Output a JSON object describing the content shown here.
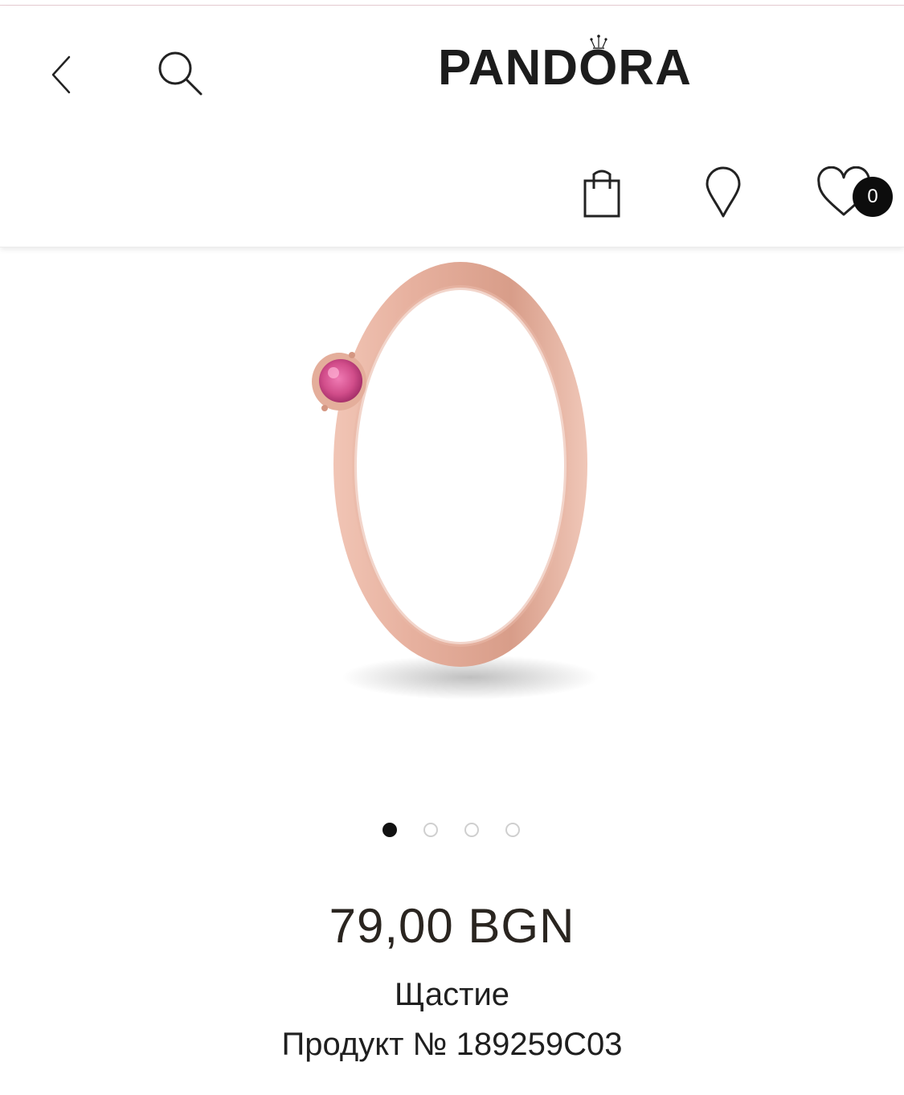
{
  "header": {
    "brand": "PANDORA",
    "wishlist_count": "0",
    "icons": {
      "back": "chevron-left-icon",
      "search": "search-icon",
      "bag": "shopping-bag-icon",
      "store_locator": "map-pin-icon",
      "wishlist": "heart-icon",
      "logo_crown": "crown-icon"
    }
  },
  "gallery": {
    "image": "rose-gold-ring-pink-stone",
    "total_images": 4,
    "active_index": 0
  },
  "product": {
    "price": "79,00 BGN",
    "name": "Щастие",
    "sku": "Продукт № 189259C03"
  },
  "colors": {
    "text": "#1f1f1f",
    "rose_gold": "#e0aa98",
    "stone_pink": "#d9508f",
    "badge": "#0d0d0d"
  }
}
